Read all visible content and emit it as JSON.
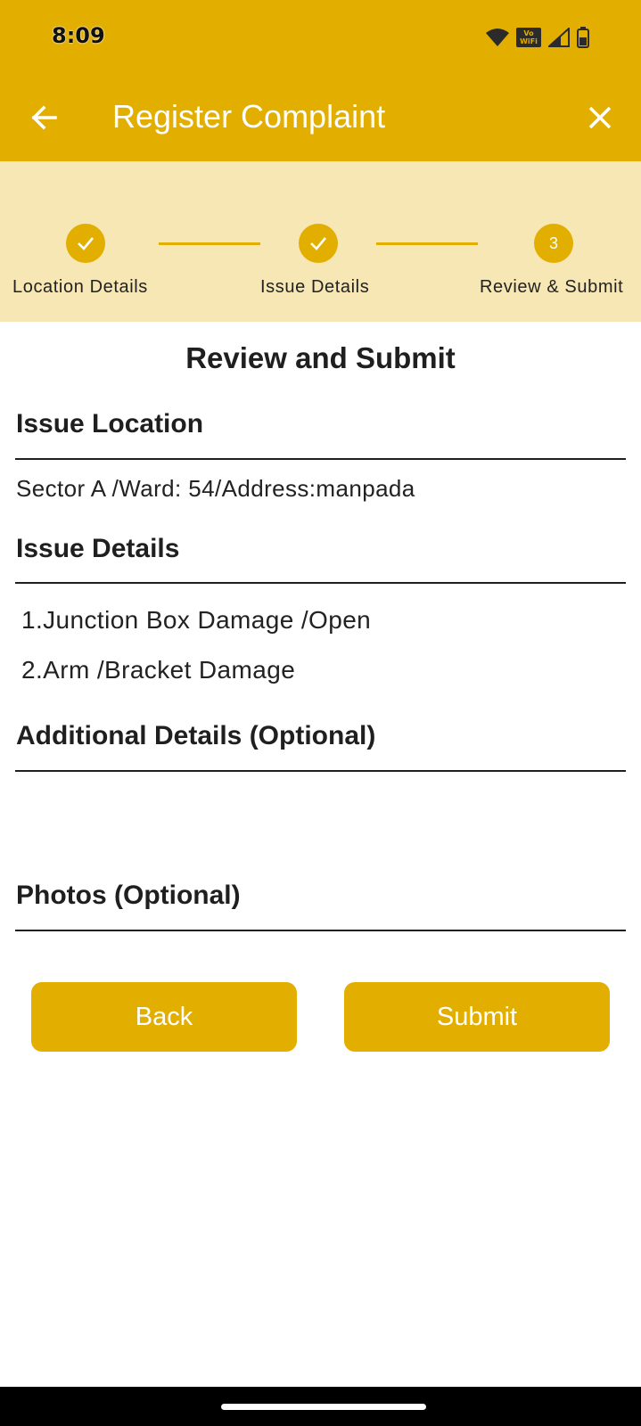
{
  "status_bar": {
    "time": "8:09",
    "vowifi_line1": "Vo",
    "vowifi_line2": "WiFi",
    "icons": [
      "wifi-icon",
      "vowifi-icon",
      "signal-icon",
      "battery-icon"
    ]
  },
  "app_bar": {
    "title": "Register Complaint",
    "back_icon": "arrow-left-icon",
    "close_icon": "close-icon"
  },
  "stepper": {
    "steps": [
      {
        "label": "Location Details",
        "state": "completed",
        "icon": "check-icon"
      },
      {
        "label": "Issue Details",
        "state": "completed",
        "icon": "check-icon"
      },
      {
        "label": "Review & Submit",
        "state": "active",
        "number": "3"
      }
    ]
  },
  "review": {
    "heading": "Review and Submit",
    "issue_location": {
      "title": "Issue Location",
      "value": "Sector A /Ward: 54/Address:manpada"
    },
    "issue_details": {
      "title": "Issue Details",
      "items": [
        "1.Junction Box Damage /Open",
        "2.Arm /Bracket Damage"
      ]
    },
    "additional_details": {
      "title": "Additional Details (Optional)"
    },
    "photos": {
      "title": "Photos (Optional)"
    }
  },
  "actions": {
    "back_label": "Back",
    "submit_label": "Submit"
  },
  "colors": {
    "accent": "#e2ae00",
    "stepper_bg": "#f6e7b4",
    "text": "#222222"
  }
}
